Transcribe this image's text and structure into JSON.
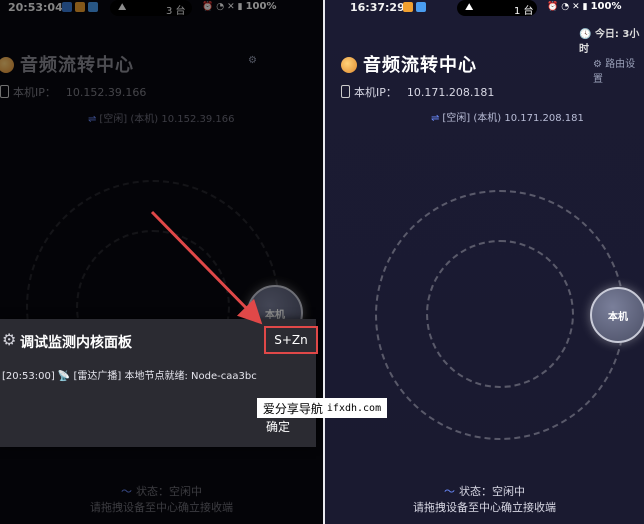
{
  "left": {
    "status": {
      "time": "20:53:04",
      "cast_count": "3 台",
      "battery": "100%"
    },
    "title": "音频流转中心",
    "ip_label": "本机IP：",
    "ip_value": "10.152.39.166",
    "peer": "[空闲] (本机) 10.152.39.166",
    "node_label": "本机",
    "footer_status": "状态：空闲中",
    "footer_hint": "请拖拽设备至中心确立接收端",
    "modal": {
      "title": "调试监测内核面板",
      "tag": "S+Zn",
      "log": "[20:53:00] 📡 [雷达广播] 本地节点就绪: Node-caa3bc",
      "confirm": "确定"
    }
  },
  "right": {
    "status": {
      "time": "16:37:29",
      "cast_count": "1 台",
      "battery": "100%"
    },
    "today": "今日: 3小时",
    "title": "音频流转中心",
    "settings": "路由设置",
    "ip_label": "本机IP：",
    "ip_value": "10.171.208.181",
    "peer": "[空闲] (本机) 10.171.208.181",
    "node_label": "本机",
    "footer_status": "状态：空闲中",
    "footer_hint": "请拖拽设备至中心确立接收端"
  },
  "watermark": {
    "text": "爱分享导航",
    "domain": "ifxdh.com"
  },
  "colors": {
    "accent": "#6c8cff",
    "highlight": "#e04848"
  }
}
